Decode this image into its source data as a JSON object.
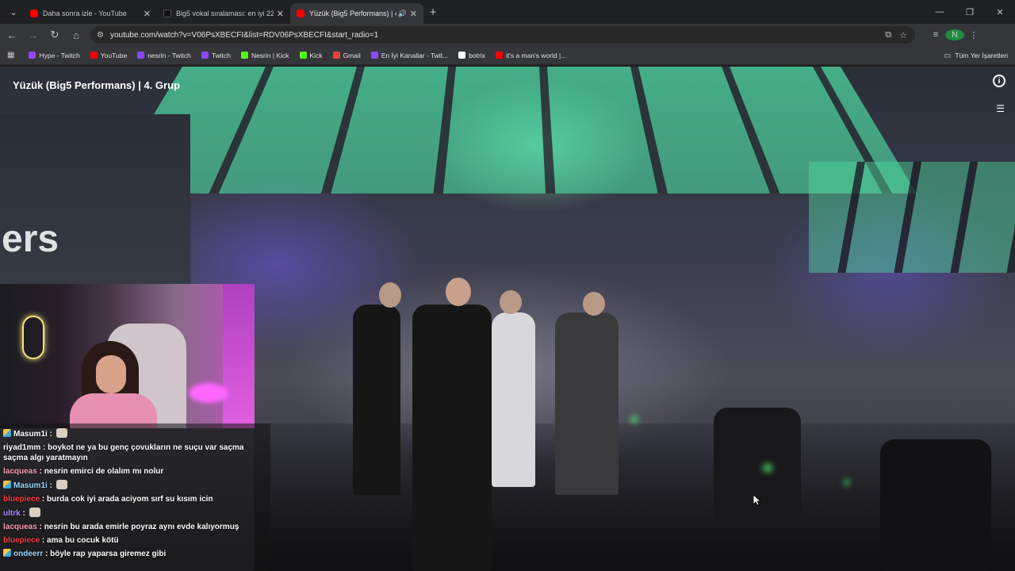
{
  "tabs": [
    {
      "title": "Daha sonra izle - YouTube",
      "favicon_color": "#ff0000",
      "active": false
    },
    {
      "title": "Big5 vokal sıralaması: en iyi 22-...",
      "favicon_color": "#000000",
      "active": false
    },
    {
      "title": "Yüzük (Big5 Performans) | 4...",
      "favicon_color": "#ff0000",
      "active": true
    }
  ],
  "toolbar": {
    "url": "youtube.com/watch?v=V06PsXBECFI&list=RDV06PsXBECFI&start_radio=1",
    "profile_initial": "N"
  },
  "bookmarks": [
    {
      "label": "Hype - Twitch",
      "color": "#9146ff"
    },
    {
      "label": "YouTube",
      "color": "#ff0000"
    },
    {
      "label": "nesrin - Twitch",
      "color": "#9146ff"
    },
    {
      "label": "Twitch",
      "color": "#9146ff"
    },
    {
      "label": "Nesrin | Kick",
      "color": "#53fc18"
    },
    {
      "label": "Kick",
      "color": "#53fc18"
    },
    {
      "label": "Gmail",
      "color": "#ea4335"
    },
    {
      "label": "En İyi Kanallar - Twit...",
      "color": "#9146ff"
    },
    {
      "label": "botrix",
      "color": "#ffffff"
    },
    {
      "label": "it's a man's world |...",
      "color": "#ff0000"
    }
  ],
  "all_bookmarks_label": "Tüm Yer İşaretleri",
  "video": {
    "title": "Yüzük (Big5 Performans) | 4. Grup",
    "wall_text": "ers"
  },
  "chat": [
    {
      "user": "Masum1i",
      "color": "#ffffff",
      "badge": true,
      "text": "",
      "emote": true
    },
    {
      "user": "riyad1mm",
      "color": "#ffffff",
      "badge": false,
      "text": "boykot ne ya bu genç çovukların ne suçu var saçma saçma algı yaratmayın",
      "emote": false
    },
    {
      "user": "lacqueas",
      "color": "#ff9eb5",
      "badge": false,
      "text": "nesrin emirci de olalım mı nolur",
      "emote": false
    },
    {
      "user": "Masum1i",
      "color": "#9ad8ff",
      "badge": true,
      "text": "",
      "emote": true
    },
    {
      "user": "bluepiece",
      "color": "#ff3b3b",
      "badge": false,
      "text": "burda cok iyi arada aciyom sırf su kısım icin",
      "emote": false
    },
    {
      "user": "ultrk",
      "color": "#b18cff",
      "badge": false,
      "text": "",
      "emote": true
    },
    {
      "user": "lacqueas",
      "color": "#ff9eb5",
      "badge": false,
      "text": "nesrin bu arada emirle poyraz aynı evde kalıyormuş",
      "emote": false
    },
    {
      "user": "bluepiece",
      "color": "#ff3b3b",
      "badge": false,
      "text": "ama bu cocuk kötü",
      "emote": false
    },
    {
      "user": "ondeerr",
      "color": "#9ad8ff",
      "badge": true,
      "text": "böyle rap yaparsa giremez gibi",
      "emote": false
    }
  ]
}
